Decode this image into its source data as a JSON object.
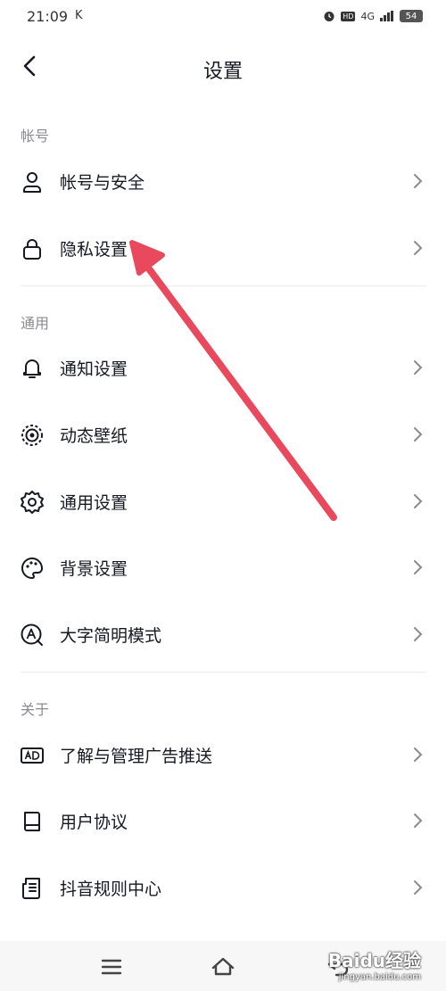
{
  "status": {
    "time": "21:09",
    "carrier_icon": "K",
    "network": "4G",
    "hd": "HD",
    "battery": "54"
  },
  "header": {
    "title": "设置"
  },
  "sections": [
    {
      "label": "帐号"
    },
    {
      "label": "通用"
    },
    {
      "label": "关于"
    }
  ],
  "items": [
    {
      "label": "帐号与安全",
      "icon": "user-icon"
    },
    {
      "label": "隐私设置",
      "icon": "lock-icon"
    },
    {
      "label": "通知设置",
      "icon": "bell-icon"
    },
    {
      "label": "动态壁纸",
      "icon": "wallpaper-icon"
    },
    {
      "label": "通用设置",
      "icon": "gear-icon"
    },
    {
      "label": "背景设置",
      "icon": "palette-icon"
    },
    {
      "label": "大字简明模式",
      "icon": "large-font-icon"
    },
    {
      "label": "了解与管理广告推送",
      "icon": "ad-icon"
    },
    {
      "label": "用户协议",
      "icon": "book-icon"
    },
    {
      "label": "抖音规则中心",
      "icon": "rules-icon"
    }
  ],
  "watermark": {
    "brand": "Baidu经验",
    "url": "jingyan.baidu.com"
  },
  "colors": {
    "arrow": "#e8495c",
    "text": "#161823",
    "muted": "#8a8b91"
  }
}
